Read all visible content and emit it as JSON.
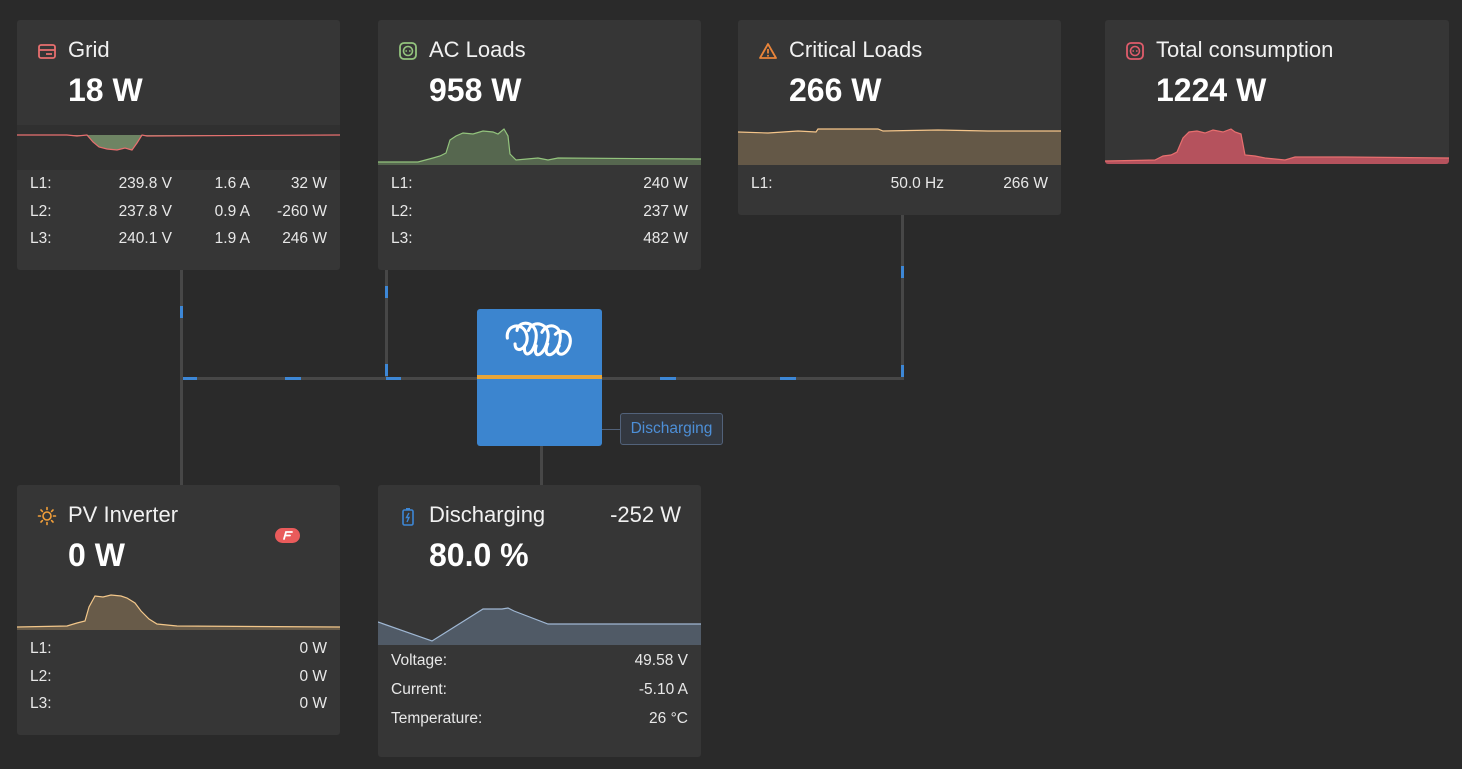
{
  "grid": {
    "title": "Grid",
    "value": "18 W",
    "icon": "grid-icon",
    "rows": [
      {
        "label": "L1:",
        "voltage": "239.8 V",
        "current": "1.6 A",
        "power": "32 W"
      },
      {
        "label": "L2:",
        "voltage": "237.8 V",
        "current": "0.9 A",
        "power": "-260 W"
      },
      {
        "label": "L3:",
        "voltage": "240.1 V",
        "current": "1.9 A",
        "power": "246 W"
      }
    ]
  },
  "ac_loads": {
    "title": "AC Loads",
    "value": "958 W",
    "icon": "socket-icon",
    "rows": [
      {
        "label": "L1:",
        "power": "240 W"
      },
      {
        "label": "L2:",
        "power": "237 W"
      },
      {
        "label": "L3:",
        "power": "482 W"
      }
    ]
  },
  "critical_loads": {
    "title": "Critical Loads",
    "value": "266 W",
    "icon": "warning-triangle-icon",
    "rows": [
      {
        "label": "L1:",
        "frequency": "50.0 Hz",
        "power": "266 W"
      }
    ]
  },
  "total_consumption": {
    "title": "Total consumption",
    "value": "1224 W",
    "icon": "socket-icon"
  },
  "pv_inverter": {
    "title": "PV Inverter",
    "value": "0 W",
    "icon": "sun-icon",
    "badge_icon": "fronius-logo-icon",
    "rows": [
      {
        "label": "L1:",
        "power": "0 W"
      },
      {
        "label": "L2:",
        "power": "0 W"
      },
      {
        "label": "L3:",
        "power": "0 W"
      }
    ]
  },
  "battery": {
    "title": "Discharging",
    "power": "-252 W",
    "value": "80.0 %",
    "icon": "battery-icon",
    "rows": [
      {
        "label": "Voltage:",
        "value": "49.58 V"
      },
      {
        "label": "Current:",
        "value": "-5.10 A"
      },
      {
        "label": "Temperature:",
        "value": "26 °C"
      }
    ]
  },
  "inverter": {
    "status": "Discharging",
    "logo": "victron-logo-icon"
  },
  "colors": {
    "background": "#2a2a2a",
    "card": "#363636",
    "grid": "#e86f6f",
    "ac_loads": "#93c47d",
    "critical_loads": "#f5c58a",
    "total_consumption": "#e05c6b",
    "pv": "#f3c78a",
    "battery": "#9fb7d3",
    "inverter": "#3c85cf",
    "flow": "#3d87d6"
  }
}
